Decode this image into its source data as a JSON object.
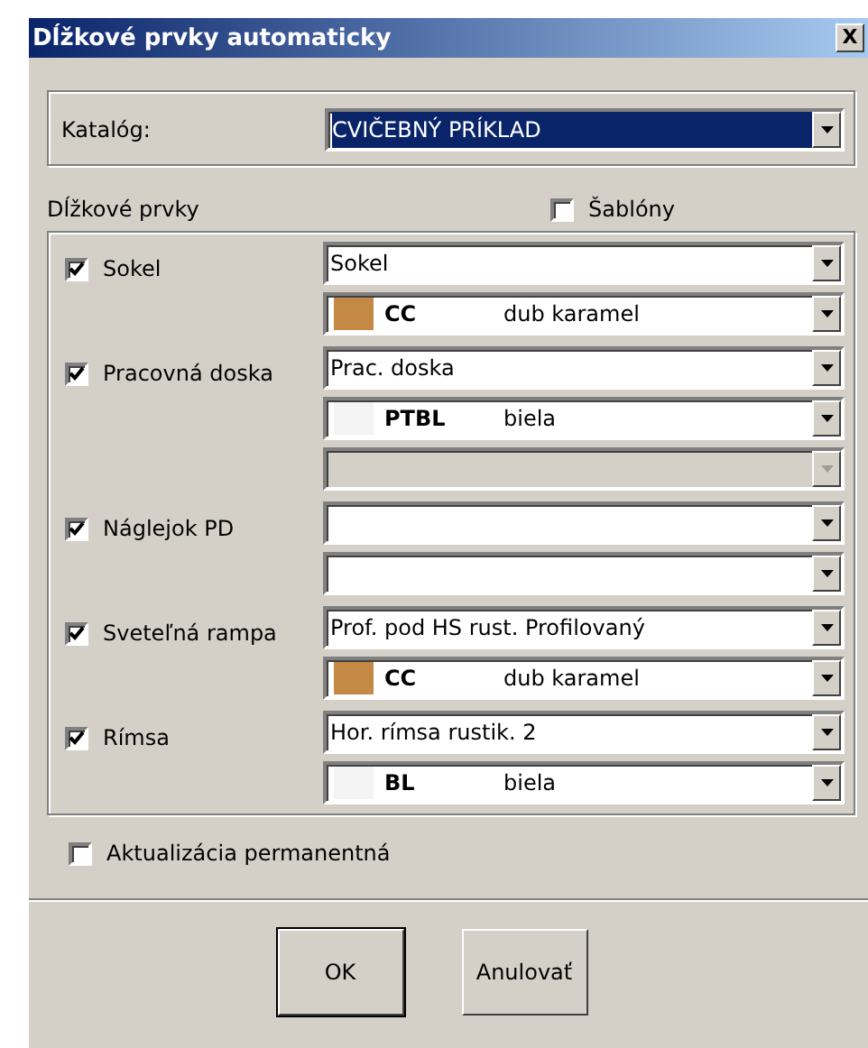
{
  "window": {
    "title": "Dĺžkové prvky automaticky",
    "close": "X"
  },
  "catalog": {
    "label": "Katalóg:",
    "value": "CVIČEBNÝ PRÍKLAD",
    "focused": true
  },
  "section": {
    "label": "Dĺžkové prvky",
    "templates": {
      "label": "Šablóny",
      "checked": false
    }
  },
  "rows": [
    {
      "label": "Sokel",
      "checked": true,
      "combos": [
        {
          "kind": "text",
          "value": "Sokel",
          "disabled": false
        },
        {
          "kind": "material",
          "color": "#c48a45",
          "code": "CC",
          "name": "dub karamel",
          "disabled": false
        }
      ]
    },
    {
      "label": "Pracovná doska",
      "checked": true,
      "combos": [
        {
          "kind": "text",
          "value": "Prac. doska",
          "disabled": false
        },
        {
          "kind": "material",
          "color": "#f4f4f4",
          "code": "PTBL",
          "name": "biela",
          "disabled": false
        },
        {
          "kind": "text",
          "disabled": true
        }
      ]
    },
    {
      "label": "Náglejok PD",
      "checked": true,
      "combos": [
        {
          "kind": "text",
          "disabled": false
        },
        {
          "kind": "text",
          "disabled": false
        }
      ]
    },
    {
      "label": "Sveteľná rampa",
      "checked": true,
      "combos": [
        {
          "kind": "text",
          "value": "Prof. pod HS rust. Profilovaný",
          "disabled": false
        },
        {
          "kind": "material",
          "color": "#c48a45",
          "code": "CC",
          "name": "dub karamel",
          "disabled": false
        }
      ]
    },
    {
      "label": "Rímsa",
      "checked": true,
      "combos": [
        {
          "kind": "text",
          "value": "Hor. rímsa rustik. 2",
          "disabled": false
        },
        {
          "kind": "material",
          "color": "#f4f4f4",
          "code": "BL",
          "name": "biela",
          "disabled": false
        }
      ]
    }
  ],
  "permanent": {
    "label": "Aktualizácia permanentná",
    "checked": false
  },
  "buttons": [
    {
      "label": "OK",
      "default": true
    },
    {
      "label": "Anulovať",
      "default": false
    }
  ]
}
